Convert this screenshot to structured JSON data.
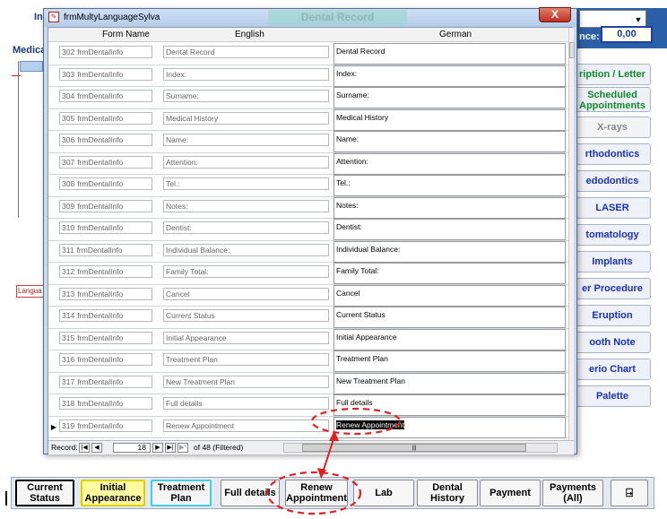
{
  "background": {
    "left_labels": [
      "In",
      "Medica"
    ],
    "lang_badge": "Langua",
    "balance_label": "nce:",
    "balance_value": "0,00",
    "side_buttons": [
      {
        "label": "ription / Letter",
        "style": "green"
      },
      {
        "label": "Scheduled Appointments",
        "style": "green-two"
      },
      {
        "label": "X-rays",
        "style": "gray"
      },
      {
        "label": "rthodontics",
        "style": "blue"
      },
      {
        "label": "edodontics",
        "style": "blue"
      },
      {
        "label": "LASER",
        "style": "blue"
      },
      {
        "label": "tomatology",
        "style": "blue"
      },
      {
        "label": "Implants",
        "style": "blue"
      },
      {
        "label": "er Procedure",
        "style": "blue"
      },
      {
        "label": "Eruption",
        "style": "blue"
      },
      {
        "label": "ooth Note",
        "style": "blue"
      },
      {
        "label": "erio Chart",
        "style": "blue"
      },
      {
        "label": "Palette",
        "style": "blue"
      }
    ]
  },
  "toolbar": {
    "buttons": [
      {
        "label": "Current Status",
        "style": "current"
      },
      {
        "label": "Initial Appearance",
        "style": "yellow"
      },
      {
        "label": "Treatment Plan",
        "style": "cyan"
      },
      {
        "label": "Full details",
        "style": "normal"
      },
      {
        "label": "Renew Appointment",
        "style": "normal"
      },
      {
        "label": "Lab",
        "style": "normal"
      },
      {
        "label": "Dental History",
        "style": "normal"
      },
      {
        "label": "Payment",
        "style": "normal"
      },
      {
        "label": "Payments (All)",
        "style": "normal"
      }
    ],
    "exit_icon": "exit-door-icon"
  },
  "dialog": {
    "title": "frmMultyLanguageSylva",
    "faded_title": "Dental Record",
    "close_glyph": "X",
    "columns": {
      "form_name": "Form Name",
      "english": "English",
      "german": "German"
    },
    "rows": [
      {
        "id": "302",
        "form": "frmDentalInfo",
        "english": "Dental Record",
        "german": "Dental Record"
      },
      {
        "id": "303",
        "form": "frmDentalInfo",
        "english": "Index:",
        "german": "Index:"
      },
      {
        "id": "304",
        "form": "frmDentalInfo",
        "english": "Surname:",
        "german": "Surname:"
      },
      {
        "id": "305",
        "form": "frmDentalInfo",
        "english": "Medical History",
        "german": "Medical History"
      },
      {
        "id": "306",
        "form": "frmDentalInfo",
        "english": "Name:",
        "german": "Name:"
      },
      {
        "id": "307",
        "form": "frmDentalInfo",
        "english": "Attention:",
        "german": "Attention:"
      },
      {
        "id": "308",
        "form": "frmDentalInfo",
        "english": "Tel.:",
        "german": "Tel.:"
      },
      {
        "id": "309",
        "form": "frmDentalInfo",
        "english": "Notes:",
        "german": "Notes:"
      },
      {
        "id": "310",
        "form": "frmDentalInfo",
        "english": "Dentist:",
        "german": "Dentist:"
      },
      {
        "id": "311",
        "form": "frmDentalInfo",
        "english": "Individual Balance:",
        "german": "Individual Balance:"
      },
      {
        "id": "312",
        "form": "frmDentalInfo",
        "english": "Family Total:",
        "german": "Family Total:"
      },
      {
        "id": "313",
        "form": "frmDentalInfo",
        "english": "Cancel",
        "german": "Cancel"
      },
      {
        "id": "314",
        "form": "frmDentalInfo",
        "english": "Current Status",
        "german": "Current Status"
      },
      {
        "id": "315",
        "form": "frmDentalInfo",
        "english": "Initial Appearance",
        "german": "Initial Appearance"
      },
      {
        "id": "316",
        "form": "frmDentalInfo",
        "english": "Treatment Plan",
        "german": "Treatment Plan"
      },
      {
        "id": "317",
        "form": "frmDentalInfo",
        "english": "New Treatment Plan",
        "german": "New Treatment Plan"
      },
      {
        "id": "318",
        "form": "frmDentalInfo",
        "english": "Full details",
        "german": "Full details"
      },
      {
        "id": "319",
        "form": "frmDentalInfo",
        "english": "Renew Appointment",
        "german": "Renew Appointment",
        "current": true
      }
    ],
    "navigation": {
      "record_label": "Record:",
      "current_record": "18",
      "of_text": "of 48 (Filtered)"
    }
  },
  "annotation_color": "#e02020"
}
